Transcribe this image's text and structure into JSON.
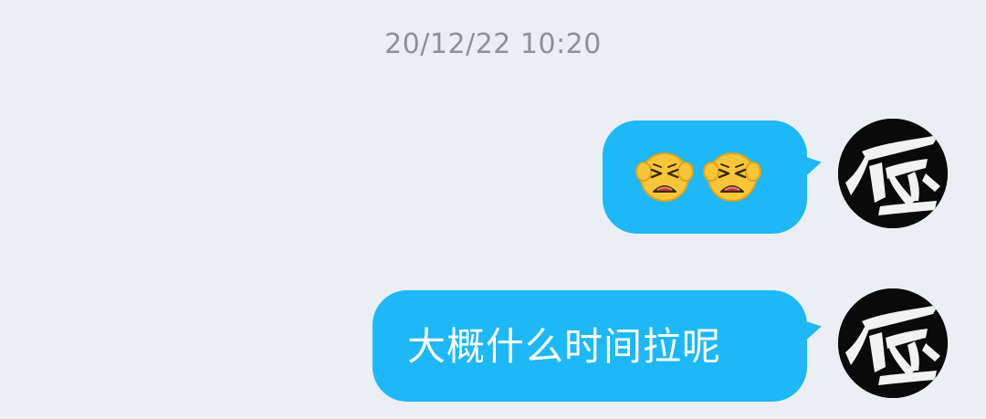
{
  "chat": {
    "timestamp": "20/12/22 10:20",
    "messages": [
      {
        "sender": "self",
        "type": "emoji",
        "emoji": [
          "distressed-face-emoji",
          "distressed-face-emoji"
        ]
      },
      {
        "sender": "self",
        "type": "text",
        "text": "大概什么时间拉呢"
      }
    ]
  },
  "colors": {
    "background": "#EBEEF5",
    "bubble": "#1EB8F6",
    "timestamp": "#8E9095",
    "avatar_bg": "#0A0A0A"
  }
}
